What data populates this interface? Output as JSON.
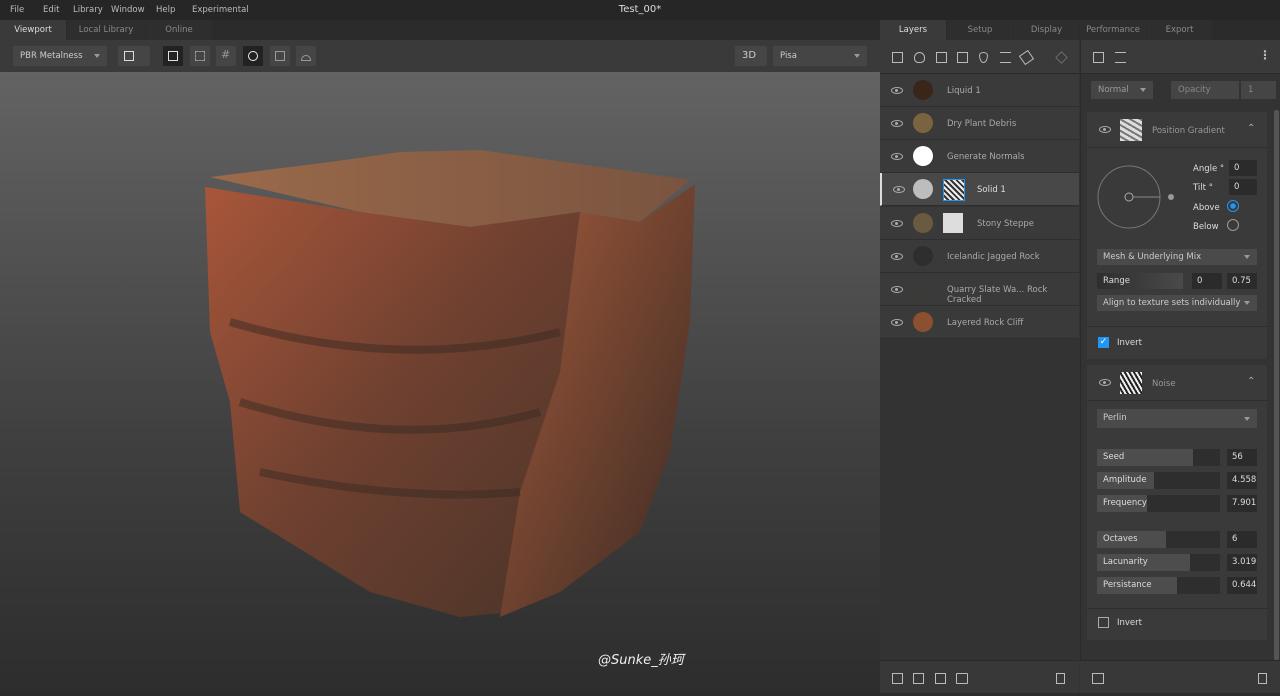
{
  "menu": [
    "File",
    "Edit",
    "Library",
    "Window",
    "Help",
    "Experimental"
  ],
  "title": "Test_00*",
  "left_tabs": [
    "Viewport",
    "Local Library",
    "Online"
  ],
  "toolbar": {
    "shader": "PBR Metalness",
    "view_mode": "3D",
    "environment": "Pisa"
  },
  "watermark": "@Sunke_孙珂",
  "right_tabs": [
    "Layers",
    "Setup",
    "Display",
    "Performance",
    "Export"
  ],
  "layers": [
    {
      "name": "Liquid 1",
      "thumb": "#3a2618"
    },
    {
      "name": "Dry Plant Debris",
      "thumb": "#7a6440"
    },
    {
      "name": "Generate Normals",
      "thumb": "#ffffff"
    },
    {
      "name": "Solid 1",
      "thumb": "#bdbdbd",
      "selected": true
    },
    {
      "name": "Stony Steppe",
      "thumb": "#6a5a40"
    },
    {
      "name": "Icelandic Jagged Rock",
      "thumb": "#2e2e2e"
    },
    {
      "name": "Quarry Slate Wa... Rock Cracked",
      "thumb": "#3a3a38"
    },
    {
      "name": "Layered Rock Cliff",
      "thumb": "#8a5030"
    }
  ],
  "props": {
    "blend": "Normal",
    "opacity_label": "Opacity",
    "opacity": "1",
    "position_gradient": {
      "title": "Position Gradient",
      "angle_label": "Angle °",
      "angle": "0",
      "tilt_label": "Tilt °",
      "tilt": "0",
      "above": "Above",
      "below": "Below",
      "selected": "Above",
      "mode": "Mesh & Underlying Mix",
      "range_label": "Range",
      "range_min": "0",
      "range_max": "0.75",
      "align": "Align to texture sets individually",
      "invert_label": "Invert",
      "invert": true
    },
    "noise": {
      "title": "Noise",
      "type": "Perlin",
      "params": [
        {
          "label": "Seed",
          "value": "56",
          "fill": 0.78
        },
        {
          "label": "Amplitude",
          "value": "4.558",
          "fill": 0.46
        },
        {
          "label": "Frequency",
          "value": "7.901",
          "fill": 0.41
        },
        {
          "label": "Octaves",
          "value": "6",
          "fill": 0.56
        },
        {
          "label": "Lacunarity",
          "value": "3.019",
          "fill": 0.76
        },
        {
          "label": "Persistance",
          "value": "0.644",
          "fill": 0.65
        }
      ],
      "invert_label": "Invert",
      "invert": false
    }
  },
  "colors": {
    "accent": "#2196f3"
  }
}
